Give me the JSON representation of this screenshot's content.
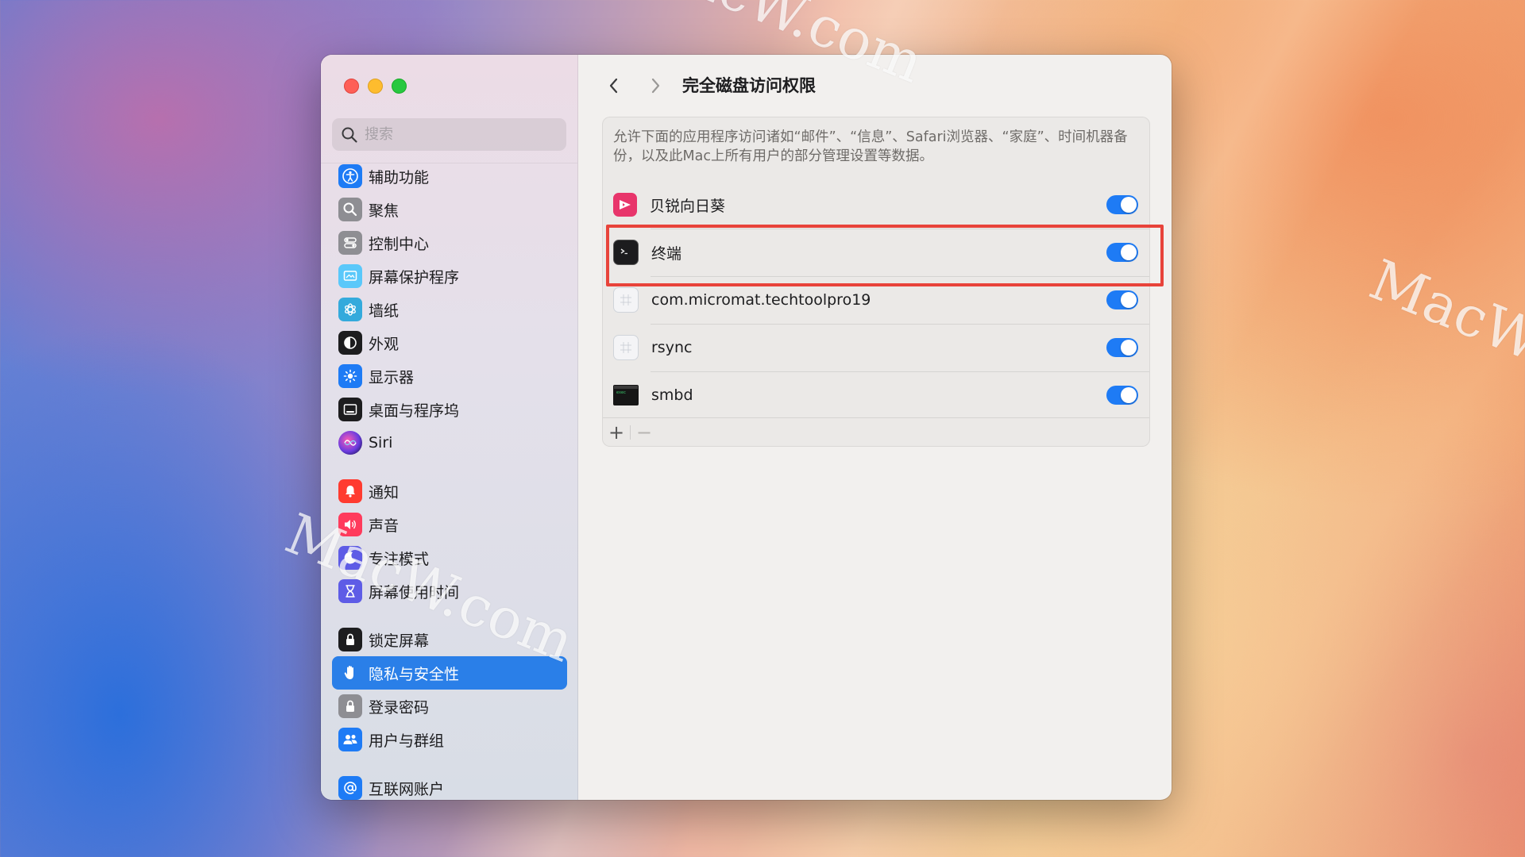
{
  "watermark": "MacW.com",
  "window": {
    "title": "完全磁盘访问权限"
  },
  "sidebar": {
    "search_placeholder": "搜索",
    "items": [
      {
        "label": "辅助功能",
        "icon": "accessibility-icon",
        "color": "#1e7bf5"
      },
      {
        "label": "聚焦",
        "icon": "spotlight-icon",
        "color": "#8e8e93"
      },
      {
        "label": "控制中心",
        "icon": "control-center-icon",
        "color": "#8e8e93"
      },
      {
        "label": "屏幕保护程序",
        "icon": "screensaver-icon",
        "color": "#5ac8fa"
      },
      {
        "label": "墙纸",
        "icon": "wallpaper-icon",
        "color": "#34aadc"
      },
      {
        "label": "外观",
        "icon": "appearance-icon",
        "color": "#1d1d1f"
      },
      {
        "label": "显示器",
        "icon": "display-icon",
        "color": "#1e7bf5"
      },
      {
        "label": "桌面与程序坞",
        "icon": "dock-icon",
        "color": "#1d1d1f"
      },
      {
        "label": "Siri",
        "icon": "siri-icon",
        "color": "#5e3ac8"
      },
      {
        "label": "通知",
        "icon": "notifications-icon",
        "color": "#ff3b30"
      },
      {
        "label": "声音",
        "icon": "sound-icon",
        "color": "#ff3b5c"
      },
      {
        "label": "专注模式",
        "icon": "focus-icon",
        "color": "#5e5ce6"
      },
      {
        "label": "屏幕使用时间",
        "icon": "screen-time-icon",
        "color": "#5e5ce6"
      },
      {
        "label": "锁定屏幕",
        "icon": "lock-screen-icon",
        "color": "#1d1d1f"
      },
      {
        "label": "隐私与安全性",
        "icon": "privacy-hand-icon",
        "color": "#1e7bf5"
      },
      {
        "label": "登录密码",
        "icon": "password-lock-icon",
        "color": "#8e8e93"
      },
      {
        "label": "用户与群组",
        "icon": "users-icon",
        "color": "#1e7bf5"
      },
      {
        "label": "互联网账户",
        "icon": "internet-accounts-icon",
        "color": "#1e7bf5"
      }
    ],
    "selected_index": 14
  },
  "main": {
    "description": "允许下面的应用程序访问诸如“邮件”、“信息”、Safari浏览器、“家庭”、时间机器备份，以及此Mac上所有用户的部分管理设置等数据。",
    "apps": [
      {
        "name": "贝锐向日葵",
        "icon": "sunlogin-icon",
        "enabled": true
      },
      {
        "name": "终端",
        "icon": "terminal-icon",
        "enabled": true
      },
      {
        "name": "com.micromat.techtoolpro19",
        "icon": "generic-app-icon",
        "enabled": true
      },
      {
        "name": "rsync",
        "icon": "generic-app-icon",
        "enabled": true
      },
      {
        "name": "smbd",
        "icon": "exec-icon",
        "enabled": true
      }
    ],
    "add_label": "+",
    "remove_label": "−"
  },
  "colors": {
    "accent": "#1e7bf5",
    "highlight": "#e8433a"
  }
}
